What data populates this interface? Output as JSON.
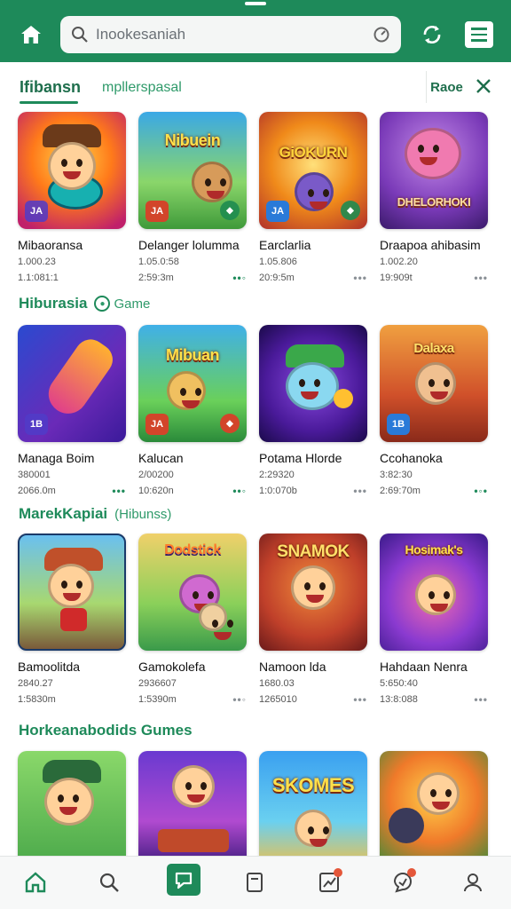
{
  "header": {
    "search_placeholder": "Inookesaniah"
  },
  "tabs": {
    "active": "Ifibansn",
    "second": "mpllerspasal",
    "side_label": "Raoe"
  },
  "sections": [
    {
      "title": "",
      "cards": [
        {
          "name": "Mibaoransa",
          "meta1": "1.000.23",
          "meta2": "1.1:081:1"
        },
        {
          "name": "Delanger lolumma",
          "meta1": "1.05.0:58",
          "meta2": "2:59:3m"
        },
        {
          "name": "Earclarlia",
          "meta1": "1.05.806",
          "meta2": "20:9:5m"
        },
        {
          "name": "Draapoa ahibasim",
          "meta1": "1.002.20",
          "meta2": "19:909t"
        }
      ]
    },
    {
      "title": "Hiburasia",
      "badge": "Game",
      "cards": [
        {
          "name": "Managa Boim",
          "meta1": "380001",
          "meta2": "2066.0m"
        },
        {
          "name": "Kalucan",
          "meta1": "2/00200",
          "meta2": "10:620n"
        },
        {
          "name": "Potama Hlorde",
          "meta1": "2:29320",
          "meta2": "1:0:070b"
        },
        {
          "name": "Ccohanoka",
          "meta1": "3:82:30",
          "meta2": "2:69:70m"
        }
      ]
    },
    {
      "title": "MarekKapiai",
      "subtitle": "(Hibunss)",
      "cards": [
        {
          "name": "Bamoolitda",
          "meta1": "2840.27",
          "meta2": "1:5830m"
        },
        {
          "name": "Gamokolefa",
          "meta1": "2936607",
          "meta2": "1:5390m"
        },
        {
          "name": "Namoon lda",
          "meta1": "1680.03",
          "meta2": "1265010"
        },
        {
          "name": "Hahdaan Nenra",
          "meta1": "5:650:40",
          "meta2": "13:8:088"
        }
      ]
    },
    {
      "title": "Horkeanabodids Gumes",
      "cards": [
        {
          "name": "",
          "meta1": "",
          "meta2": ""
        },
        {
          "name": "",
          "meta1": "",
          "meta2": ""
        },
        {
          "name": "",
          "meta1": "",
          "meta2": ""
        },
        {
          "name": "",
          "meta1": "",
          "meta2": ""
        }
      ]
    }
  ],
  "thumbs": {
    "r1": [
      {
        "text": "",
        "badge": "JA"
      },
      {
        "text": "Nibuein",
        "badge": "JA"
      },
      {
        "text": "GiOKURN",
        "badge": "JA"
      },
      {
        "text": "DHELORHOKI",
        "badge": ""
      }
    ],
    "r2": [
      {
        "text": "",
        "badge": "1B"
      },
      {
        "text": "Mibuan",
        "badge": "JA"
      },
      {
        "text": "",
        "badge": ""
      },
      {
        "text": "Dalaxa",
        "badge": "1B"
      }
    ],
    "r3": [
      {
        "text": "",
        "badge": ""
      },
      {
        "text": "Dodstick",
        "badge": ""
      },
      {
        "text": "SNAMOK",
        "badge": ""
      },
      {
        "text": "Hosimak's",
        "badge": ""
      }
    ],
    "r4": [
      {
        "text": "",
        "badge": ""
      },
      {
        "text": "",
        "badge": ""
      },
      {
        "text": "SKOMES",
        "badge": ""
      },
      {
        "text": "",
        "badge": ""
      }
    ]
  },
  "theme": {
    "brand": "#1e8a5a"
  }
}
